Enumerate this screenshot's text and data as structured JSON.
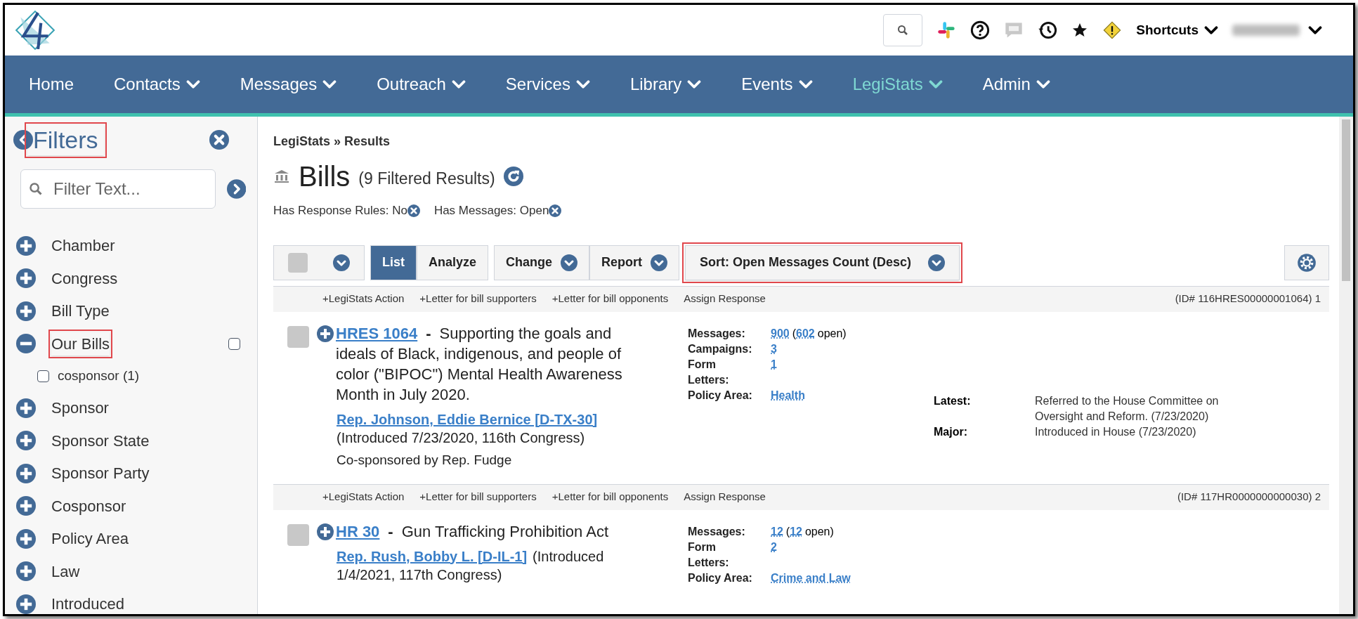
{
  "header": {
    "shortcuts": "Shortcuts"
  },
  "nav": [
    {
      "label": "Home",
      "selected": false,
      "dropdown": false
    },
    {
      "label": "Contacts",
      "selected": false,
      "dropdown": true
    },
    {
      "label": "Messages",
      "selected": false,
      "dropdown": true
    },
    {
      "label": "Outreach",
      "selected": false,
      "dropdown": true
    },
    {
      "label": "Services",
      "selected": false,
      "dropdown": true
    },
    {
      "label": "Library",
      "selected": false,
      "dropdown": true
    },
    {
      "label": "Events",
      "selected": false,
      "dropdown": true
    },
    {
      "label": "LegiStats",
      "selected": true,
      "dropdown": true
    },
    {
      "label": "Admin",
      "selected": false,
      "dropdown": true
    }
  ],
  "sidebar": {
    "title": "Filters",
    "title_highlighted": true,
    "search": {
      "placeholder": "Filter Text..."
    },
    "filters": [
      {
        "label": "Chamber",
        "expanded": false,
        "highlighted": false
      },
      {
        "label": "Congress",
        "expanded": false,
        "highlighted": false
      },
      {
        "label": "Bill Type",
        "expanded": false,
        "highlighted": false
      },
      {
        "label": "Our Bills",
        "expanded": true,
        "highlighted": true,
        "checked": false,
        "children": [
          {
            "label": "cosponsor (1)",
            "checked": false
          }
        ]
      },
      {
        "label": "Sponsor",
        "expanded": false,
        "highlighted": false
      },
      {
        "label": "Sponsor State",
        "expanded": false,
        "highlighted": false
      },
      {
        "label": "Sponsor Party",
        "expanded": false,
        "highlighted": false
      },
      {
        "label": "Cosponsor",
        "expanded": false,
        "highlighted": false
      },
      {
        "label": "Policy Area",
        "expanded": false,
        "highlighted": false
      },
      {
        "label": "Law",
        "expanded": false,
        "highlighted": false
      },
      {
        "label": "Introduced",
        "expanded": false,
        "highlighted": false
      }
    ]
  },
  "main": {
    "breadcrumb": "LegiStats » Results",
    "title": "Bills",
    "subtitle": "(9 Filtered Results)",
    "active_filters": [
      {
        "label": "Has Response Rules: No"
      },
      {
        "label": "Has Messages: Open"
      }
    ],
    "toolbar": {
      "select_all_checked": false,
      "views": [
        {
          "label": "List",
          "selected": true
        },
        {
          "label": "Analyze",
          "selected": false
        }
      ],
      "change": "Change",
      "report": "Report",
      "sort": "Sort: Open Messages Count (Desc)",
      "sort_highlighted": true
    },
    "results": [
      {
        "actions": [
          "+LegiStats Action",
          "+Letter for bill supporters",
          "+Letter for bill opponents",
          "Assign Response"
        ],
        "id": "(ID# 116HRES00000001064) 1",
        "checked": false,
        "bill": "HRES 1064",
        "dash": "-",
        "description": "Supporting the goals and ideals of Black, indigenous, and people of color (\"BIPOC\") Mental Health Awareness Month in July 2020.",
        "sponsor": "Rep. Johnson, Eddie Bernice [D-TX-30]",
        "introduced": "(Introduced 7/23/2020, 116th Congress)",
        "cosponsored": "Co-sponsored by Rep. Fudge",
        "stats": [
          {
            "label": "Messages:",
            "value": "900",
            "open_count": "602",
            "open_label": "open)",
            "open_prefix": "("
          },
          {
            "label": "Campaigns:",
            "value": "3"
          },
          {
            "label": "Form",
            "value": "1"
          },
          {
            "label": "Letters:"
          },
          {
            "label": "Policy Area:",
            "value": "Health"
          }
        ],
        "status": [
          {
            "label": "Latest:",
            "value": "Referred to the House Committee on Oversight and Reform. (7/23/2020)"
          },
          {
            "label": "Major:",
            "value": "Introduced in House (7/23/2020)"
          }
        ]
      },
      {
        "actions": [
          "+LegiStats Action",
          "+Letter for bill supporters",
          "+Letter for bill opponents",
          "Assign Response"
        ],
        "id": "(ID# 117HR0000000000030) 2",
        "checked": false,
        "bill": "HR 30",
        "dash": "-",
        "description": "Gun Trafficking Prohibition Act",
        "sponsor": "Rep. Rush, Bobby L. [D-IL-1]",
        "introduced": "(Introduced 1/4/2021, 117th Congress)",
        "stats": [
          {
            "label": "Messages:",
            "value": "12",
            "open_count": "12",
            "open_label": "open)",
            "open_prefix": "("
          },
          {
            "label": "Form",
            "value": "2"
          },
          {
            "label": "Letters:"
          },
          {
            "label": "Policy Area:",
            "value": "Crime and Law"
          }
        ]
      }
    ]
  }
}
